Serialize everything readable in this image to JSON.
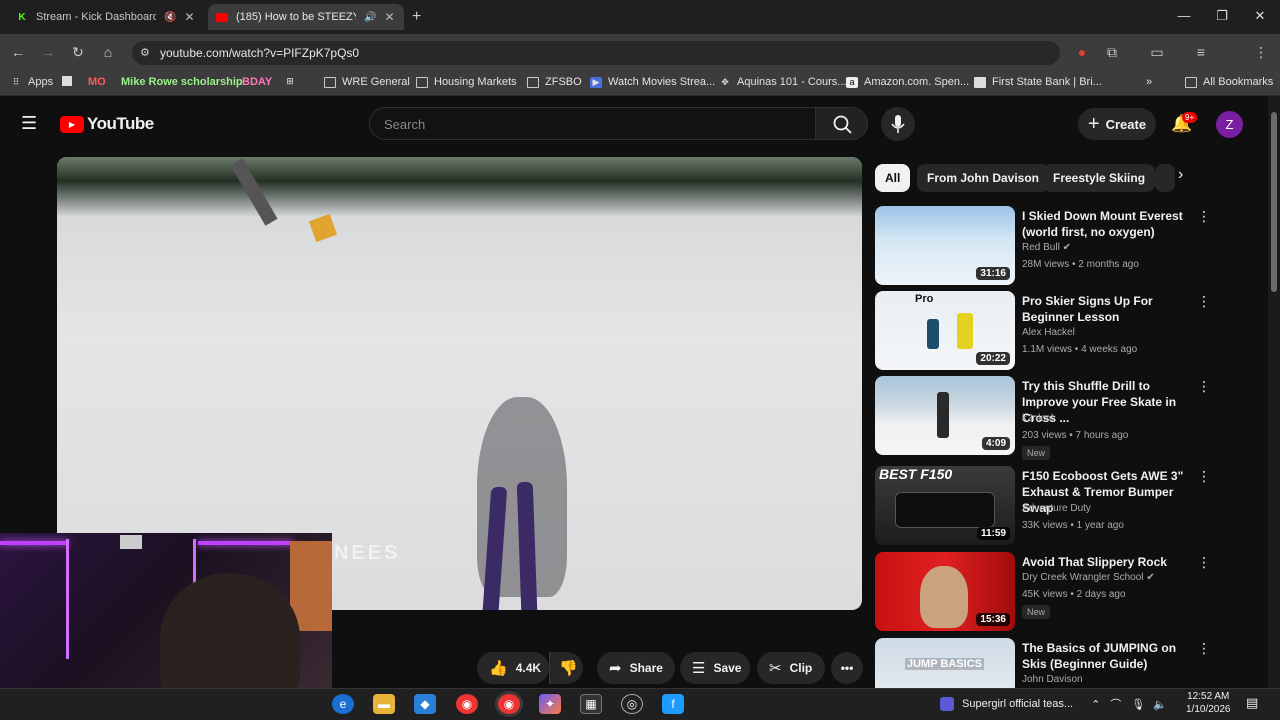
{
  "browser": {
    "tabs": [
      {
        "title": "Stream - Kick Dashboard",
        "active": false,
        "icon": "kick-icon",
        "color": "#53fc18"
      },
      {
        "title": "(185) How to be STEEZY on",
        "active": true,
        "icon": "youtube-icon",
        "color": "#ff0000"
      }
    ],
    "new_tab": "+",
    "url": "youtube.com/watch?v=PIFZpK7pQs0",
    "bookmarks": [
      "Apps",
      "MO",
      "Mike Rowe scholarship",
      "BDAY",
      "WRE General",
      "Housing Markets",
      "ZFSBO",
      "Watch Movies Strea...",
      "Aquinas 101 - Cours...",
      "Amazon.com. Spen...",
      "First State Bank | Bri...",
      "All Bookmarks"
    ],
    "more_bookmarks": "»"
  },
  "youtube": {
    "logo_text": "YouTube",
    "search_placeholder": "Search",
    "create_label": "Create",
    "notif_badge": "9+",
    "avatar_letter": "Z",
    "video_overlay_text": "NEES",
    "actions": {
      "likes": "4.4K",
      "share": "Share",
      "save": "Save",
      "clip": "Clip"
    },
    "chips": [
      "All",
      "From John Davison",
      "Freestyle Skiing"
    ],
    "recommendations": [
      {
        "title": "I Skied Down Mount Everest (world first, no oxygen)",
        "channel": "Red Bull",
        "verified": true,
        "meta": "28M views • 2 months ago",
        "duration": "31:16",
        "badge": ""
      },
      {
        "title": "Pro Skier Signs Up For Beginner Lesson",
        "channel": "Alex Hackel",
        "verified": false,
        "meta": "1.1M views • 4 weeks ago",
        "duration": "20:22",
        "badge": "",
        "thumb_text": "Pro"
      },
      {
        "title": "Try this Shuffle Drill to Improve your Free Skate in Cross ...",
        "channel": "k2nlcol",
        "verified": false,
        "meta": "203 views • 7 hours ago",
        "duration": "4:09",
        "badge": "New"
      },
      {
        "title": "F150 Ecoboost Gets AWE 3\" Exhaust & Tremor Bumper Swap",
        "channel": "Adventure Duty",
        "verified": false,
        "meta": "33K views • 1 year ago",
        "duration": "11:59",
        "badge": "",
        "thumb_text": "BEST F150"
      },
      {
        "title": "Avoid That Slippery Rock",
        "channel": "Dry Creek Wrangler School",
        "verified": true,
        "meta": "45K views • 2 days ago",
        "duration": "15:36",
        "badge": "New"
      },
      {
        "title": "The Basics of JUMPING on Skis (Beginner Guide)",
        "channel": "John Davison",
        "verified": false,
        "meta": "",
        "duration": "",
        "badge": "",
        "thumb_text": "JUMP BASICS"
      }
    ]
  },
  "taskbar": {
    "media_title": "Supergirl official teas...",
    "time": "12:52 AM",
    "date": "1/10/2026"
  }
}
